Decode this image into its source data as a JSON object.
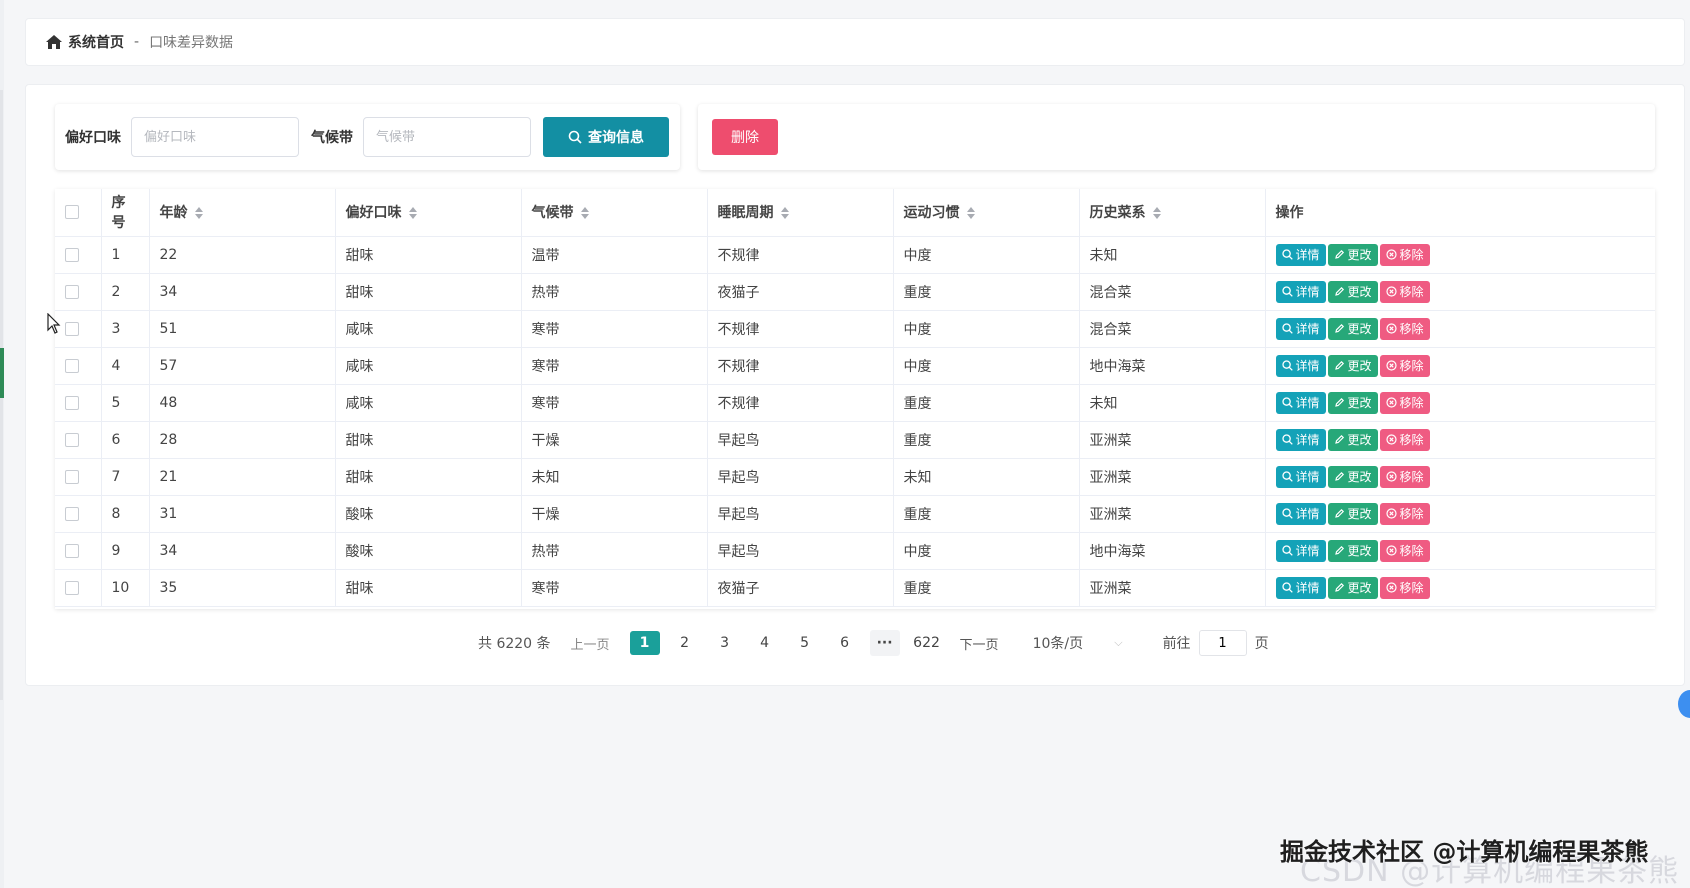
{
  "breadcrumb": {
    "home": "系统首页",
    "separator": "-",
    "current": "口味差异数据"
  },
  "search": {
    "taste_label": "偏好口味",
    "taste_placeholder": "偏好口味",
    "climate_label": "气候带",
    "climate_placeholder": "气候带",
    "query_button": "查询信息"
  },
  "actions": {
    "delete_button": "删除"
  },
  "table": {
    "headers": {
      "index": "序号",
      "age": "年龄",
      "taste": "偏好口味",
      "climate": "气候带",
      "sleep": "睡眠周期",
      "exercise": "运动习惯",
      "cuisine": "历史菜系",
      "ops": "操作"
    },
    "op_labels": {
      "detail": "详情",
      "edit": "更改",
      "remove": "移除"
    },
    "rows": [
      {
        "index": "1",
        "age": "22",
        "taste": "甜味",
        "climate": "温带",
        "sleep": "不规律",
        "exercise": "中度",
        "cuisine": "未知"
      },
      {
        "index": "2",
        "age": "34",
        "taste": "甜味",
        "climate": "热带",
        "sleep": "夜猫子",
        "exercise": "重度",
        "cuisine": "混合菜"
      },
      {
        "index": "3",
        "age": "51",
        "taste": "咸味",
        "climate": "寒带",
        "sleep": "不规律",
        "exercise": "中度",
        "cuisine": "混合菜"
      },
      {
        "index": "4",
        "age": "57",
        "taste": "咸味",
        "climate": "寒带",
        "sleep": "不规律",
        "exercise": "中度",
        "cuisine": "地中海菜"
      },
      {
        "index": "5",
        "age": "48",
        "taste": "咸味",
        "climate": "寒带",
        "sleep": "不规律",
        "exercise": "重度",
        "cuisine": "未知"
      },
      {
        "index": "6",
        "age": "28",
        "taste": "甜味",
        "climate": "干燥",
        "sleep": "早起鸟",
        "exercise": "重度",
        "cuisine": "亚洲菜"
      },
      {
        "index": "7",
        "age": "21",
        "taste": "甜味",
        "climate": "未知",
        "sleep": "早起鸟",
        "exercise": "未知",
        "cuisine": "亚洲菜"
      },
      {
        "index": "8",
        "age": "31",
        "taste": "酸味",
        "climate": "干燥",
        "sleep": "早起鸟",
        "exercise": "重度",
        "cuisine": "亚洲菜"
      },
      {
        "index": "9",
        "age": "34",
        "taste": "酸味",
        "climate": "热带",
        "sleep": "早起鸟",
        "exercise": "中度",
        "cuisine": "地中海菜"
      },
      {
        "index": "10",
        "age": "35",
        "taste": "甜味",
        "climate": "寒带",
        "sleep": "夜猫子",
        "exercise": "重度",
        "cuisine": "亚洲菜"
      }
    ]
  },
  "pagination": {
    "total": "共 6220 条",
    "prev": "上一页",
    "next": "下一页",
    "pages": [
      "1",
      "2",
      "3",
      "4",
      "5",
      "6"
    ],
    "more": "···",
    "last": "622",
    "current": "1",
    "page_size": "10条/页",
    "goto_label": "前往",
    "goto_value": "1",
    "goto_suffix": "页"
  },
  "watermark": {
    "main": "掘金技术社区 @计算机编程果茶熊",
    "faint": "CSDN @计算机编程果茶熊"
  },
  "colors": {
    "primary": "#138fa3",
    "delete": "#ee4d6e",
    "detail": "#14a2b8",
    "edit": "#27a879",
    "remove": "#ef5b82",
    "active_page": "#1aa09a"
  },
  "icons": {
    "home": "home-icon",
    "search": "search-icon",
    "detail": "search-icon",
    "edit": "pencil-icon",
    "remove": "close-circle-icon",
    "dropdown": "chevron-down-icon"
  }
}
